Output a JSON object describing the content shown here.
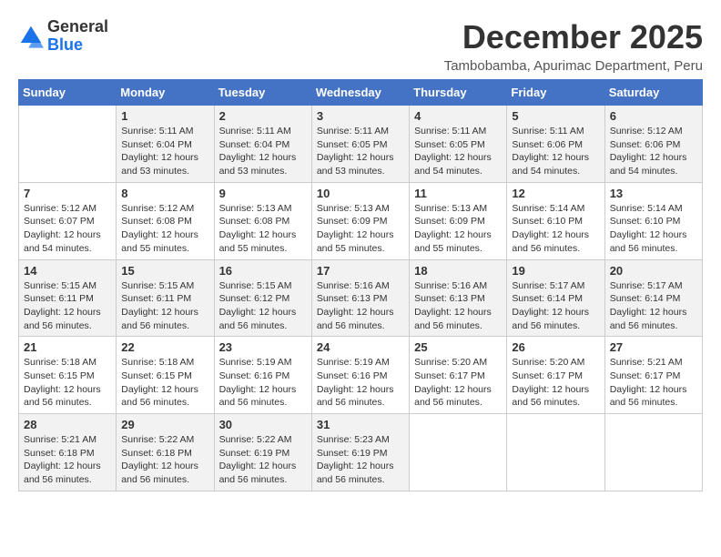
{
  "logo": {
    "general": "General",
    "blue": "Blue"
  },
  "header": {
    "month": "December 2025",
    "location": "Tambobamba, Apurimac Department, Peru"
  },
  "weekdays": [
    "Sunday",
    "Monday",
    "Tuesday",
    "Wednesday",
    "Thursday",
    "Friday",
    "Saturday"
  ],
  "weeks": [
    [
      {
        "day": "",
        "sunrise": "",
        "sunset": "",
        "daylight": ""
      },
      {
        "day": "1",
        "sunrise": "Sunrise: 5:11 AM",
        "sunset": "Sunset: 6:04 PM",
        "daylight": "Daylight: 12 hours and 53 minutes."
      },
      {
        "day": "2",
        "sunrise": "Sunrise: 5:11 AM",
        "sunset": "Sunset: 6:04 PM",
        "daylight": "Daylight: 12 hours and 53 minutes."
      },
      {
        "day": "3",
        "sunrise": "Sunrise: 5:11 AM",
        "sunset": "Sunset: 6:05 PM",
        "daylight": "Daylight: 12 hours and 53 minutes."
      },
      {
        "day": "4",
        "sunrise": "Sunrise: 5:11 AM",
        "sunset": "Sunset: 6:05 PM",
        "daylight": "Daylight: 12 hours and 54 minutes."
      },
      {
        "day": "5",
        "sunrise": "Sunrise: 5:11 AM",
        "sunset": "Sunset: 6:06 PM",
        "daylight": "Daylight: 12 hours and 54 minutes."
      },
      {
        "day": "6",
        "sunrise": "Sunrise: 5:12 AM",
        "sunset": "Sunset: 6:06 PM",
        "daylight": "Daylight: 12 hours and 54 minutes."
      }
    ],
    [
      {
        "day": "7",
        "sunrise": "Sunrise: 5:12 AM",
        "sunset": "Sunset: 6:07 PM",
        "daylight": "Daylight: 12 hours and 54 minutes."
      },
      {
        "day": "8",
        "sunrise": "Sunrise: 5:12 AM",
        "sunset": "Sunset: 6:08 PM",
        "daylight": "Daylight: 12 hours and 55 minutes."
      },
      {
        "day": "9",
        "sunrise": "Sunrise: 5:13 AM",
        "sunset": "Sunset: 6:08 PM",
        "daylight": "Daylight: 12 hours and 55 minutes."
      },
      {
        "day": "10",
        "sunrise": "Sunrise: 5:13 AM",
        "sunset": "Sunset: 6:09 PM",
        "daylight": "Daylight: 12 hours and 55 minutes."
      },
      {
        "day": "11",
        "sunrise": "Sunrise: 5:13 AM",
        "sunset": "Sunset: 6:09 PM",
        "daylight": "Daylight: 12 hours and 55 minutes."
      },
      {
        "day": "12",
        "sunrise": "Sunrise: 5:14 AM",
        "sunset": "Sunset: 6:10 PM",
        "daylight": "Daylight: 12 hours and 56 minutes."
      },
      {
        "day": "13",
        "sunrise": "Sunrise: 5:14 AM",
        "sunset": "Sunset: 6:10 PM",
        "daylight": "Daylight: 12 hours and 56 minutes."
      }
    ],
    [
      {
        "day": "14",
        "sunrise": "Sunrise: 5:15 AM",
        "sunset": "Sunset: 6:11 PM",
        "daylight": "Daylight: 12 hours and 56 minutes."
      },
      {
        "day": "15",
        "sunrise": "Sunrise: 5:15 AM",
        "sunset": "Sunset: 6:11 PM",
        "daylight": "Daylight: 12 hours and 56 minutes."
      },
      {
        "day": "16",
        "sunrise": "Sunrise: 5:15 AM",
        "sunset": "Sunset: 6:12 PM",
        "daylight": "Daylight: 12 hours and 56 minutes."
      },
      {
        "day": "17",
        "sunrise": "Sunrise: 5:16 AM",
        "sunset": "Sunset: 6:13 PM",
        "daylight": "Daylight: 12 hours and 56 minutes."
      },
      {
        "day": "18",
        "sunrise": "Sunrise: 5:16 AM",
        "sunset": "Sunset: 6:13 PM",
        "daylight": "Daylight: 12 hours and 56 minutes."
      },
      {
        "day": "19",
        "sunrise": "Sunrise: 5:17 AM",
        "sunset": "Sunset: 6:14 PM",
        "daylight": "Daylight: 12 hours and 56 minutes."
      },
      {
        "day": "20",
        "sunrise": "Sunrise: 5:17 AM",
        "sunset": "Sunset: 6:14 PM",
        "daylight": "Daylight: 12 hours and 56 minutes."
      }
    ],
    [
      {
        "day": "21",
        "sunrise": "Sunrise: 5:18 AM",
        "sunset": "Sunset: 6:15 PM",
        "daylight": "Daylight: 12 hours and 56 minutes."
      },
      {
        "day": "22",
        "sunrise": "Sunrise: 5:18 AM",
        "sunset": "Sunset: 6:15 PM",
        "daylight": "Daylight: 12 hours and 56 minutes."
      },
      {
        "day": "23",
        "sunrise": "Sunrise: 5:19 AM",
        "sunset": "Sunset: 6:16 PM",
        "daylight": "Daylight: 12 hours and 56 minutes."
      },
      {
        "day": "24",
        "sunrise": "Sunrise: 5:19 AM",
        "sunset": "Sunset: 6:16 PM",
        "daylight": "Daylight: 12 hours and 56 minutes."
      },
      {
        "day": "25",
        "sunrise": "Sunrise: 5:20 AM",
        "sunset": "Sunset: 6:17 PM",
        "daylight": "Daylight: 12 hours and 56 minutes."
      },
      {
        "day": "26",
        "sunrise": "Sunrise: 5:20 AM",
        "sunset": "Sunset: 6:17 PM",
        "daylight": "Daylight: 12 hours and 56 minutes."
      },
      {
        "day": "27",
        "sunrise": "Sunrise: 5:21 AM",
        "sunset": "Sunset: 6:17 PM",
        "daylight": "Daylight: 12 hours and 56 minutes."
      }
    ],
    [
      {
        "day": "28",
        "sunrise": "Sunrise: 5:21 AM",
        "sunset": "Sunset: 6:18 PM",
        "daylight": "Daylight: 12 hours and 56 minutes."
      },
      {
        "day": "29",
        "sunrise": "Sunrise: 5:22 AM",
        "sunset": "Sunset: 6:18 PM",
        "daylight": "Daylight: 12 hours and 56 minutes."
      },
      {
        "day": "30",
        "sunrise": "Sunrise: 5:22 AM",
        "sunset": "Sunset: 6:19 PM",
        "daylight": "Daylight: 12 hours and 56 minutes."
      },
      {
        "day": "31",
        "sunrise": "Sunrise: 5:23 AM",
        "sunset": "Sunset: 6:19 PM",
        "daylight": "Daylight: 12 hours and 56 minutes."
      },
      {
        "day": "",
        "sunrise": "",
        "sunset": "",
        "daylight": ""
      },
      {
        "day": "",
        "sunrise": "",
        "sunset": "",
        "daylight": ""
      },
      {
        "day": "",
        "sunrise": "",
        "sunset": "",
        "daylight": ""
      }
    ]
  ]
}
